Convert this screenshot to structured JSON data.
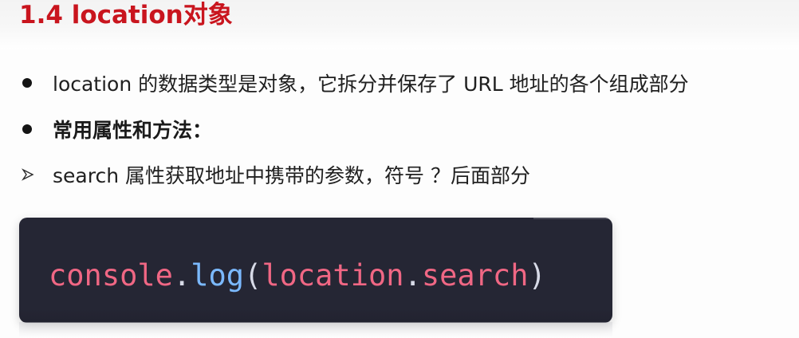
{
  "slide": {
    "title": "1.4 location对象",
    "bullets": [
      {
        "kind": "dot",
        "text": "location 的数据类型是对象，它拆分并保存了 URL 地址的各个组成部分"
      },
      {
        "kind": "dot",
        "text": "常用属性和方法："
      },
      {
        "kind": "arrow",
        "text": "search 属性获取地址中携带的参数，符号 ？后面部分"
      }
    ],
    "code": {
      "console": "console",
      "dot1": ".",
      "log": "log",
      "paren_open": "(",
      "location": "location",
      "dot2": ".",
      "search": "search",
      "paren_close": ")"
    }
  },
  "colors": {
    "title": "#c9151e",
    "code_background": "#252634",
    "code_pink": "#f06784",
    "code_blue": "#7bb9ff",
    "code_punctuation": "#d7dae7"
  },
  "icons": {
    "bullet_dot": "bullet-dot-icon",
    "bullet_arrow": "bullet-arrow-icon"
  }
}
